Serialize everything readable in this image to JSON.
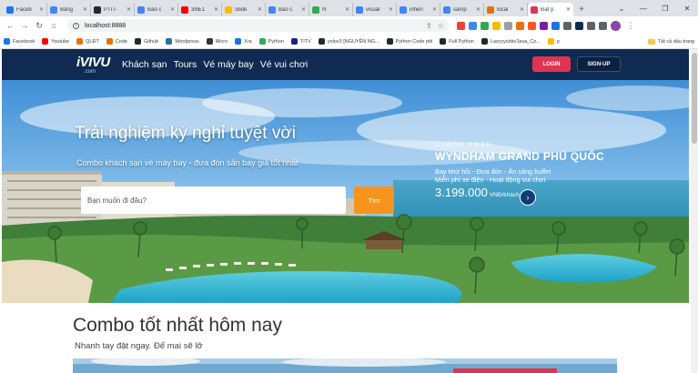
{
  "browser": {
    "tabs": [
      {
        "title": "Faceb",
        "color": "#1877f2"
      },
      {
        "title": "Bảng",
        "color": "#4285f4"
      },
      {
        "title": "PTIT-",
        "color": "#24292e"
      },
      {
        "title": "Báo c",
        "color": "#4285f4"
      },
      {
        "title": "3NE1",
        "color": "#ff0000"
      },
      {
        "title": "Slide",
        "color": "#fbbc04"
      },
      {
        "title": "Báo c",
        "color": "#4285f4"
      },
      {
        "title": "N",
        "color": "#34a853"
      },
      {
        "title": "visual",
        "color": "#4285f4"
      },
      {
        "title": "inheri",
        "color": "#4285f4"
      },
      {
        "title": "samp",
        "color": "#4285f4"
      },
      {
        "title": "local",
        "color": "#e8710a"
      },
      {
        "title": "Đặt p",
        "color": "#e03552"
      }
    ],
    "active_tab_index": 12,
    "address": "localhost:8888",
    "bookmarks": [
      {
        "label": "Facebook",
        "color": "#1877f2"
      },
      {
        "label": "Youtube",
        "color": "#ff0000"
      },
      {
        "label": "QLĐT",
        "color": "#e8710a"
      },
      {
        "label": "Code",
        "color": "#e8710a"
      },
      {
        "label": "Github",
        "color": "#24292e"
      },
      {
        "label": "Wordpress",
        "color": "#21759b"
      },
      {
        "label": "Micro",
        "color": "#333333"
      },
      {
        "label": "Xra",
        "color": "#1a73e8"
      },
      {
        "label": "Python",
        "color": "#34a853"
      },
      {
        "label": "TITV",
        "color": "#1a237e"
      },
      {
        "label": "yolov3 [NGUYỄN NG...",
        "color": "#24292e"
      },
      {
        "label": "Python Code ptit",
        "color": "#24292e"
      },
      {
        "label": "Full Python",
        "color": "#24292e"
      },
      {
        "label": "Lazyyyside/Java_Co...",
        "color": "#24292e"
      },
      {
        "label": "p",
        "color": "#fbbc04"
      }
    ],
    "bookmarks_folder": "Tất cả dấu trang",
    "ext_colors": [
      "#ea4335",
      "#4285f4",
      "#34a853",
      "#fbbc04",
      "#9e9e9e",
      "#e8710a",
      "#ff5722",
      "#7b1fa2",
      "#1a73e8",
      "#5f6368",
      "#0f2b52",
      "#5f6368",
      "#5f6368"
    ]
  },
  "site": {
    "logo_text": "iVIVU",
    "logo_sub": ".com",
    "menu": [
      "Khách sạn",
      "Tours",
      "Vé máy bay",
      "Vé vui chơi"
    ],
    "login_label": "LOGIN",
    "signup_label": "SIGN-UP"
  },
  "hero": {
    "title": "Trải nghiệm kỳ nghỉ tuyệt vời",
    "subtitle": "Combo khách sạn vé máy bay - đưa đón sân bay giá tốt nhất",
    "search_placeholder": "Bạn muốn đi đâu?",
    "search_button": "Tìm",
    "combo": {
      "tag": "Combo 3N2Đ",
      "name": "WYNDHAM GRAND PHÚ QUỐC",
      "line1": "Bay khứ hồi - Đưa đón - Ăn sáng buffet",
      "line2": "Miễn phí xe điện - Hoạt động vui chơi",
      "price": "3.199.000",
      "unit": "VNĐ/khách"
    }
  },
  "section": {
    "title": "Combo tốt nhất hôm nay",
    "subtitle": "Nhanh tay đặt ngay. Để mai sẽ lỡ"
  }
}
